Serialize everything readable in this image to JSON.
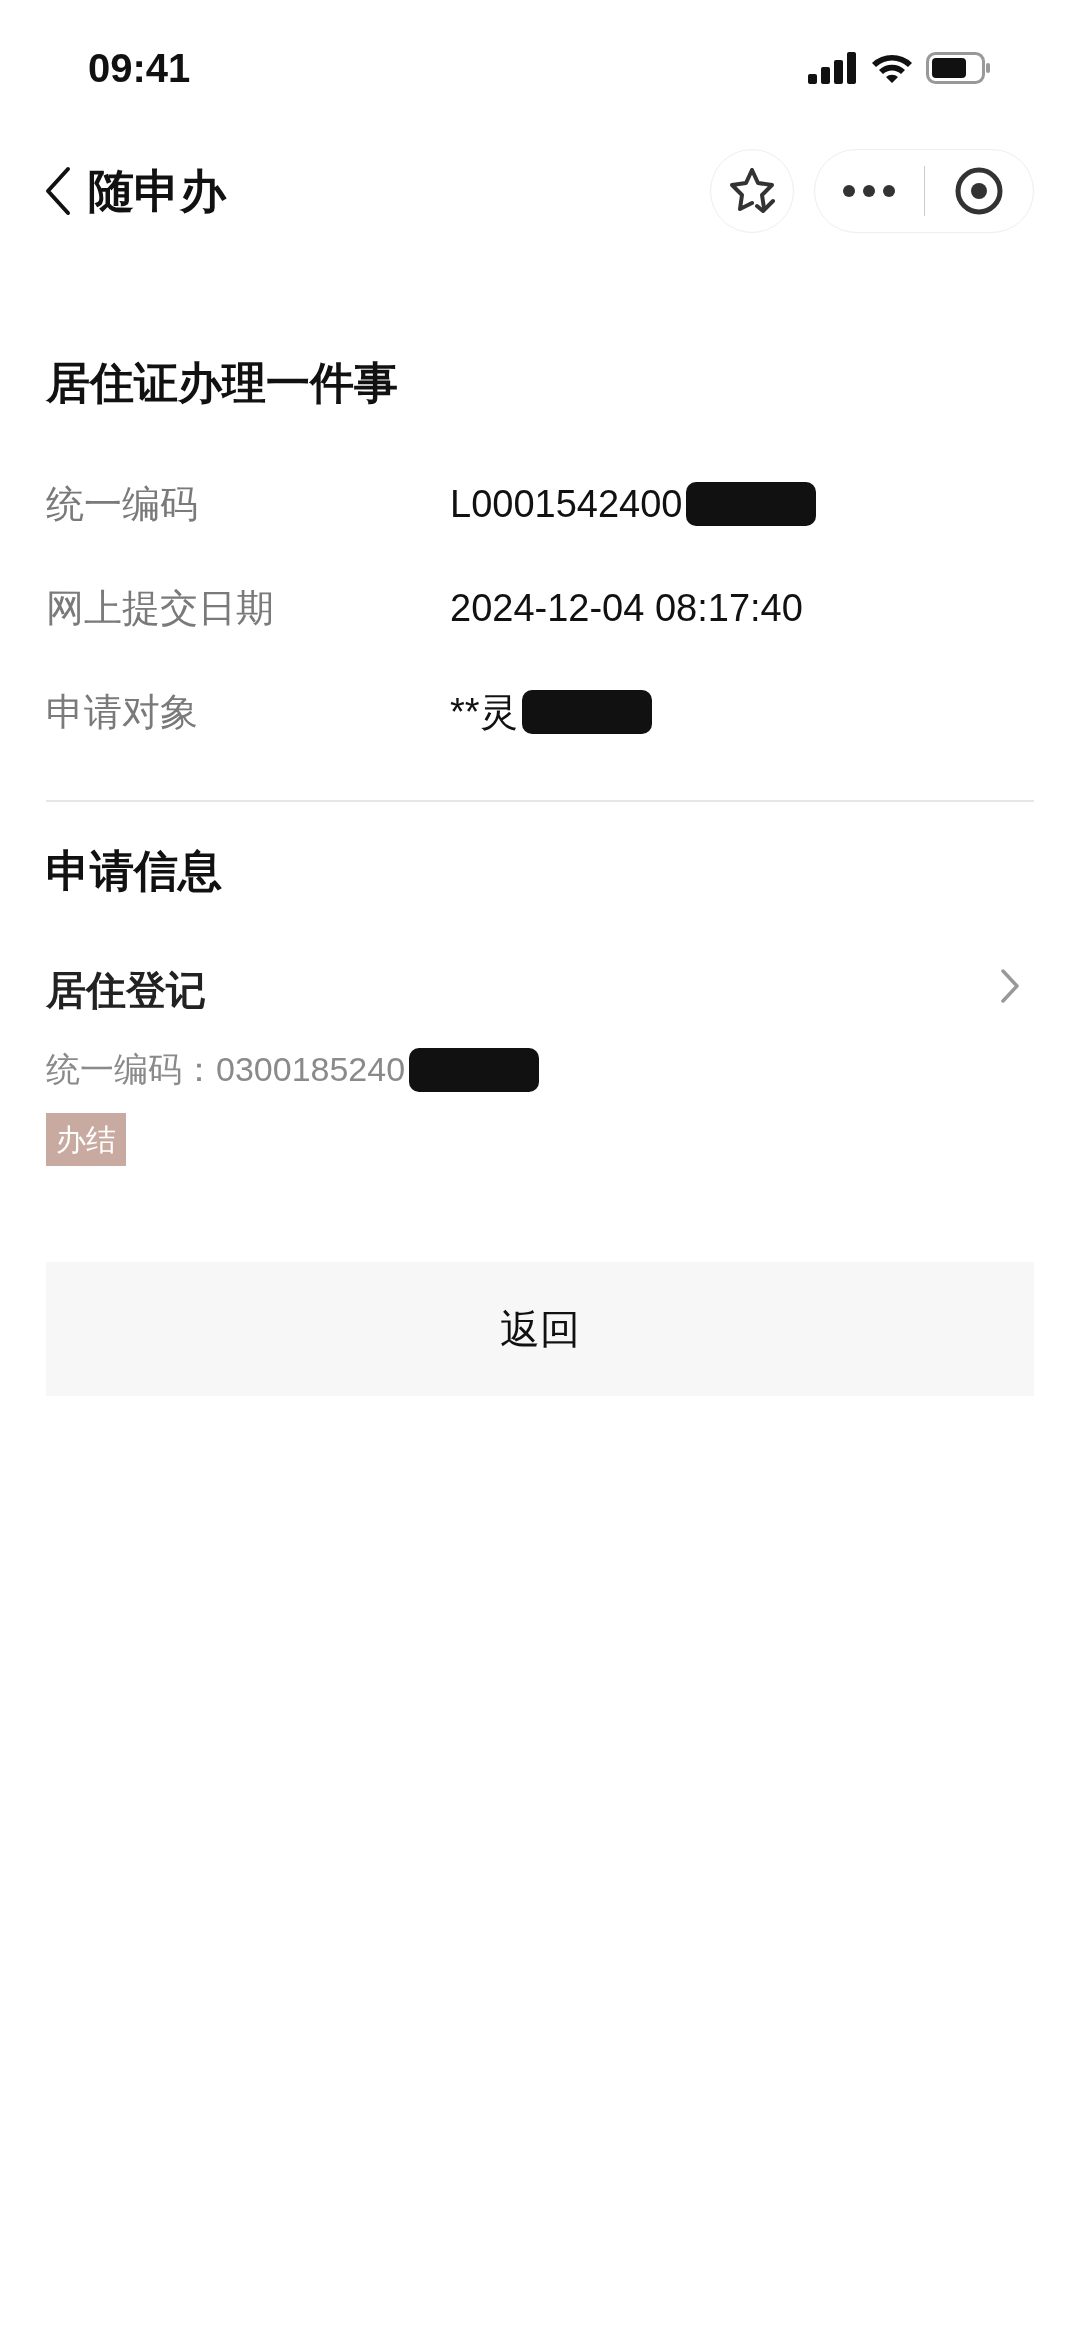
{
  "status_bar": {
    "time": "09:41"
  },
  "nav": {
    "title": "随申办"
  },
  "title": "居住证办理一件事",
  "fields": [
    {
      "label": "统一编码",
      "value": "L0001542400",
      "redacted": true
    },
    {
      "label": "网上提交日期",
      "value": "2024-12-04 08:17:40",
      "redacted": false
    },
    {
      "label": "申请对象",
      "value": "**灵",
      "redacted": true
    }
  ],
  "section_title": "申请信息",
  "item": {
    "title": "居住登记",
    "code": "统一编码：0300185240",
    "redacted": true,
    "tag": "办结"
  },
  "button": "返回"
}
